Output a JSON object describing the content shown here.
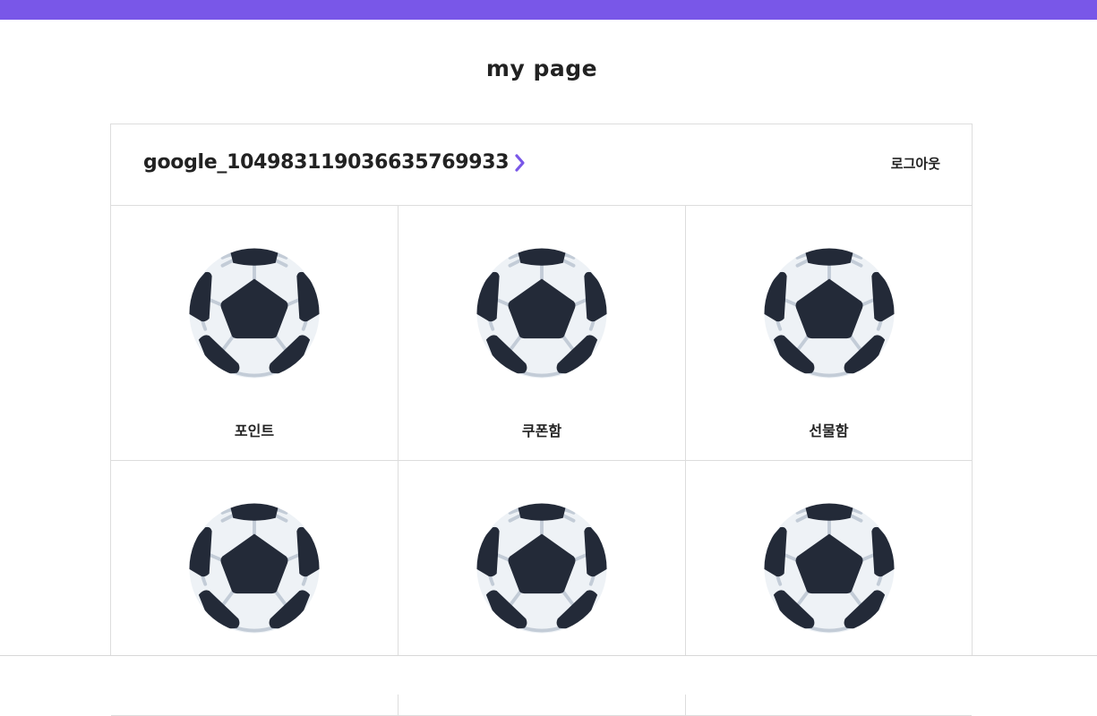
{
  "header": {
    "accent_color": "#7957e8"
  },
  "page": {
    "title": "my page"
  },
  "profile": {
    "user_id": "google_104983119036635769933",
    "chevron_icon": "chevron-right-icon",
    "logout_label": "로그아웃"
  },
  "menu": {
    "items": [
      {
        "label": "포인트",
        "icon": "soccer-ball-icon"
      },
      {
        "label": "쿠폰함",
        "icon": "soccer-ball-icon"
      },
      {
        "label": "선물함",
        "icon": "soccer-ball-icon"
      },
      {
        "label": "",
        "icon": "soccer-ball-icon"
      },
      {
        "label": "",
        "icon": "soccer-ball-icon"
      },
      {
        "label": "",
        "icon": "soccer-ball-icon"
      }
    ]
  }
}
